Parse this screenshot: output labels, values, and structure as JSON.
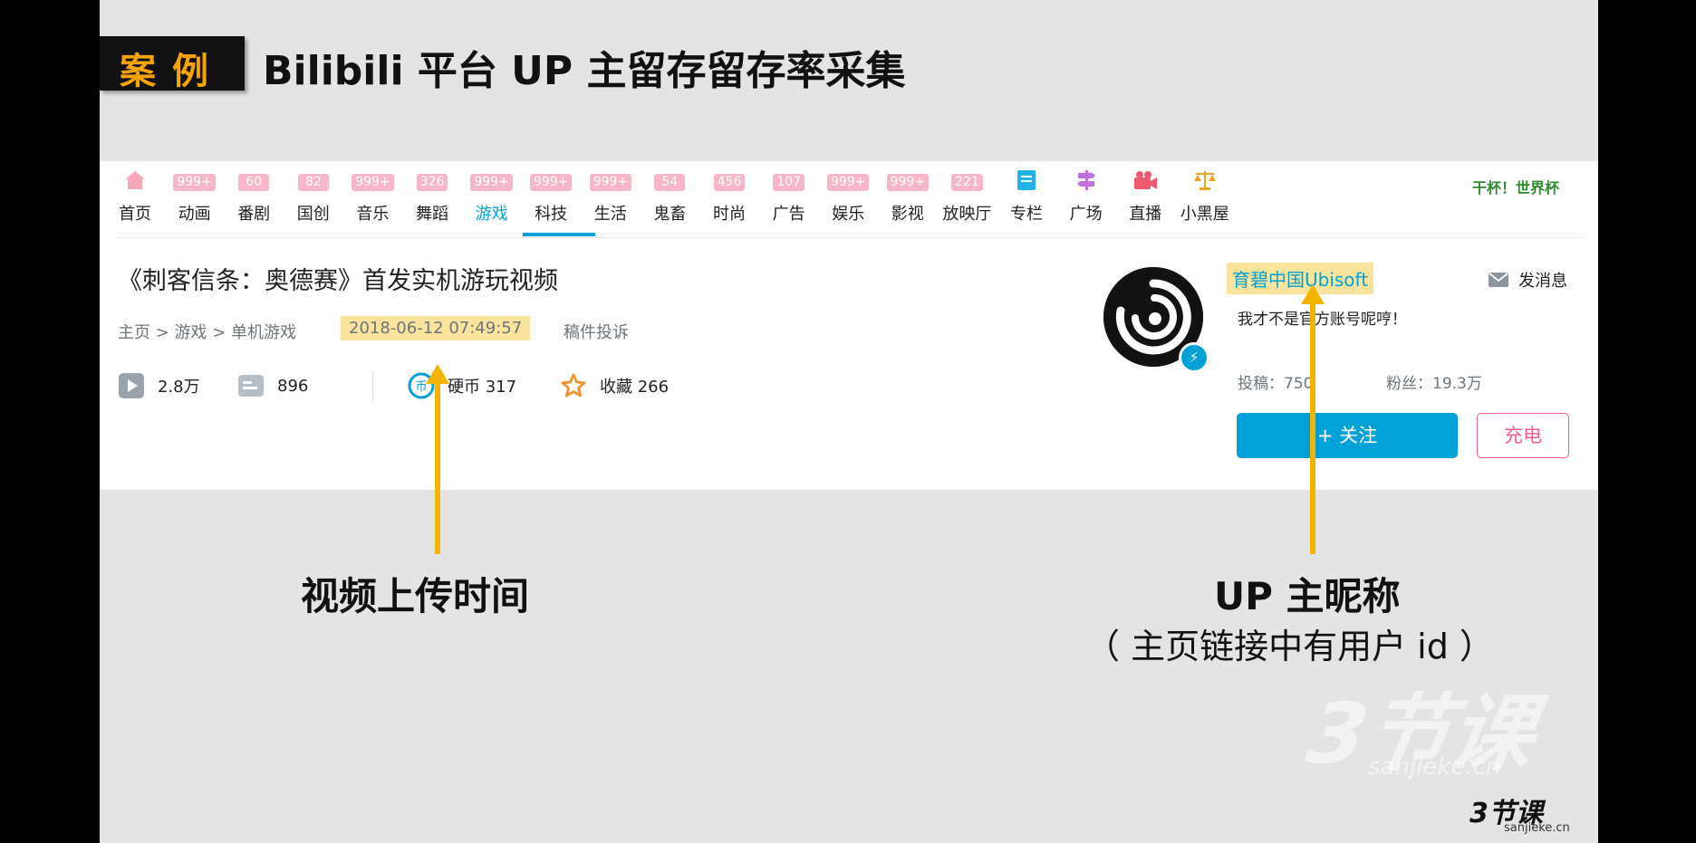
{
  "slide": {
    "badge": "案例",
    "title": "Bilibili 平台 UP 主留存留存率采集"
  },
  "nav": {
    "items": [
      {
        "label": "首页",
        "badge": "",
        "icon": "home-icon"
      },
      {
        "label": "动画",
        "badge": "999+"
      },
      {
        "label": "番剧",
        "badge": "60"
      },
      {
        "label": "国创",
        "badge": "82"
      },
      {
        "label": "音乐",
        "badge": "999+"
      },
      {
        "label": "舞蹈",
        "badge": "326"
      },
      {
        "label": "游戏",
        "badge": "999+",
        "active": true
      },
      {
        "label": "科技",
        "badge": "999+"
      },
      {
        "label": "生活",
        "badge": "999+"
      },
      {
        "label": "鬼畜",
        "badge": "54"
      },
      {
        "label": "时尚",
        "badge": "456"
      },
      {
        "label": "广告",
        "badge": "107"
      },
      {
        "label": "娱乐",
        "badge": "999+"
      },
      {
        "label": "影视",
        "badge": "999+"
      },
      {
        "label": "放映厅",
        "badge": "221"
      },
      {
        "label": "专栏",
        "badge": "",
        "icon": "column-icon"
      },
      {
        "label": "广场",
        "badge": "",
        "icon": "signpost-icon"
      },
      {
        "label": "直播",
        "badge": "",
        "icon": "live-camera-icon"
      },
      {
        "label": "小黑屋",
        "badge": "",
        "icon": "scales-icon"
      }
    ],
    "worldcup": "干杯！世界杯"
  },
  "video": {
    "title": "《刺客信条：奥德赛》首发实机游玩视频",
    "breadcrumb": "主页 > 游戏 > 单机游戏",
    "pubdate": "2018-06-12 07:49:57",
    "report": "稿件投诉",
    "views": "2.8万",
    "danmaku": "896",
    "coins": "硬币 317",
    "favorites": "收藏 266"
  },
  "uploader": {
    "name": "育碧中国Ubisoft",
    "sign": "我才不是官方账号呢哼！",
    "send_message": "发消息",
    "posts": "投稿：750",
    "fans": "粉丝：19.3万",
    "follow": "+ 关注",
    "charge": "充电"
  },
  "annotations": {
    "time_label": "视频上传时间",
    "up_label": "UP 主昵称",
    "up_note": "（ 主页链接中有用户 id ）",
    "arrow_color": "#f5b400"
  },
  "watermark": {
    "big": "3节课",
    "big_sub": "sanjieke.cn",
    "small": "3节课",
    "small_sub": "sanjieke.cn"
  },
  "colors": {
    "accent": "#00a1d6",
    "highlight": "#fae39c",
    "badge_pink": "#f7b7c8",
    "charge_pink": "#f25d8e"
  }
}
